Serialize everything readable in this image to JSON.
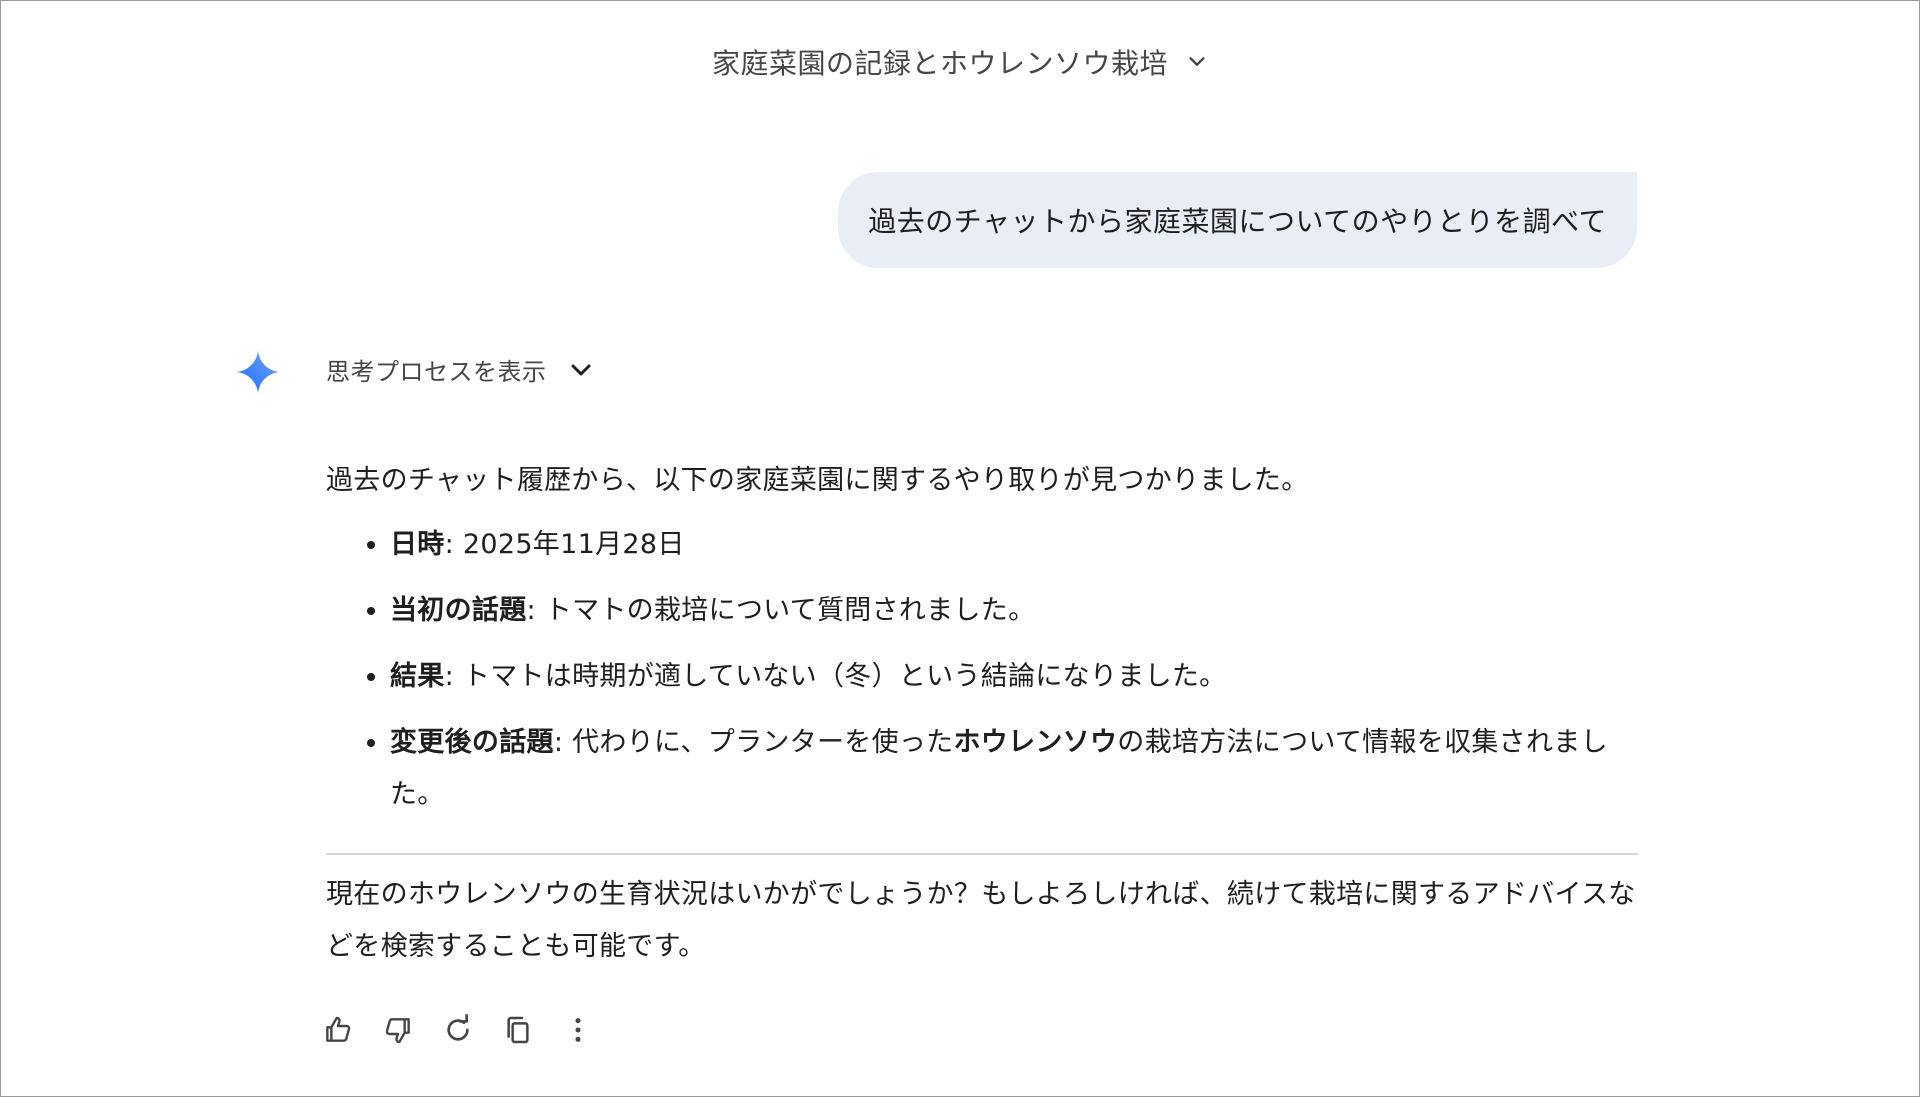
{
  "header": {
    "title": "家庭菜園の記録とホウレンソウ栽培"
  },
  "user_message": {
    "text": "過去のチャットから家庭菜園についてのやりとりを調べて"
  },
  "assistant": {
    "thinking_label": "思考プロセスを表示",
    "intro": "過去のチャット履歴から、以下の家庭菜園に関するやり取りが見つかりました。",
    "items": [
      {
        "label": "日時",
        "text": ": 2025年11月28日"
      },
      {
        "label": "当初の話題",
        "text": ": トマトの栽培について質問されました。"
      },
      {
        "label": "結果",
        "text": ": トマトは時期が適していない（冬）という結論になりました。"
      },
      {
        "label": "変更後の話題",
        "text_before": ": 代わりに、プランターを使った",
        "bold_word": "ホウレンソウ",
        "text_after": "の栽培方法について情報を収集されました。"
      }
    ],
    "closing": "現在のホウレンソウの生育状況はいかがでしょうか？もしよろしければ、続けて栽培に関するアドバイスなどを検索することも可能です。"
  },
  "icons": {
    "title_chevron": "chevron-down-icon",
    "gemini": "gemini-sparkle-icon",
    "thinking_chevron": "chevron-down-icon",
    "actions": [
      "thumbs-up-icon",
      "thumbs-down-icon",
      "regenerate-icon",
      "copy-icon",
      "more-vert-icon"
    ]
  },
  "colors": {
    "bubble": "#e9eef6",
    "text": "#1f1f1f",
    "muted": "#444746",
    "gemini_blue": "#4285f4"
  }
}
